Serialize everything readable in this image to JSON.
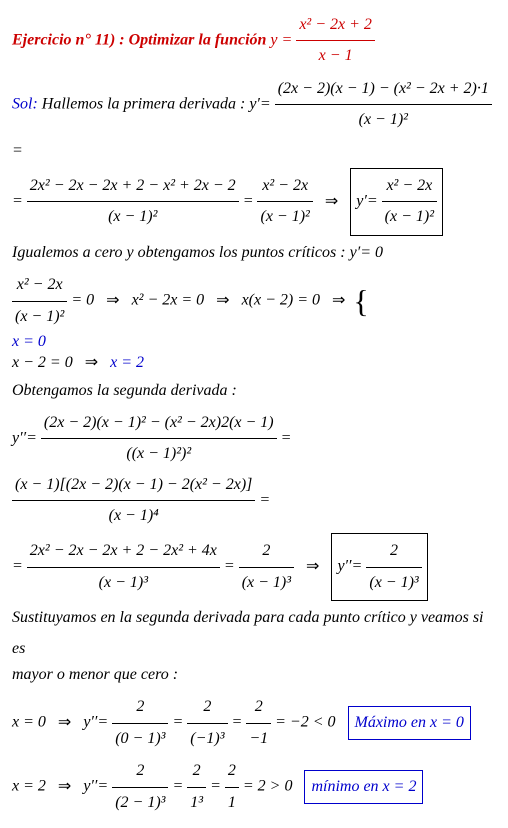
{
  "title_label": "Ejercicio n° 11)",
  "title_text": ":  Optimizar la función",
  "eq_lhs": "y =",
  "eq_num": "x² − 2x + 2",
  "eq_den": "x − 1",
  "sol_label": "Sol:",
  "line1_text": "Hallemos la primera derivada :",
  "line1_yp": "y′=",
  "line1_num": "(2x − 2)(x − 1) − (x² − 2x + 2)·1",
  "line1_den": "(x − 1)²",
  "eq_sign": "=",
  "line2_num1": "2x² − 2x − 2x + 2 − x² + 2x − 2",
  "line2_den1": "(x − 1)²",
  "line2_num2": "x² − 2x",
  "line2_den2": "(x − 1)²",
  "arrow": "⇒",
  "box1_lhs": "y′=",
  "box1_num": "x² − 2x",
  "box1_den": "(x − 1)²",
  "line3": "Igualemos a cero y obtengamos los puntos críticos :",
  "line3_eq": "y′= 0",
  "line4_num": "x² − 2x",
  "line4_den": "(x − 1)²",
  "line4_a": "= 0",
  "line4_b": "x² − 2x = 0",
  "line4_c": "x(x − 2) = 0",
  "case1": "x = 0",
  "case2": "x − 2 = 0",
  "case2_res": "x = 2",
  "line5": "Obtengamos la segunda derivada :",
  "line6_ypp": "y′′=",
  "line6_num1": "(2x − 2)(x − 1)² − (x² − 2x)2(x − 1)",
  "line6_den1": "((x − 1)²)²",
  "line6_num2": "(x − 1)[(2x − 2)(x − 1) − 2(x² − 2x)]",
  "line6_den2": "(x − 1)⁴",
  "line7_num1": "2x² − 2x − 2x + 2 − 2x² + 4x",
  "line7_den1": "(x − 1)³",
  "line7_num2": "2",
  "line7_den2": "(x − 1)³",
  "box2_lhs": "y′′=",
  "box2_num": "2",
  "box2_den": "(x − 1)³",
  "line8a": "Sustituyamos en la segunda derivada para cada punto crítico y veamos si es",
  "line8b": "mayor o menor que cero :",
  "line9_x": "x = 0",
  "line9_ypp": "y′′=",
  "line9_f1n": "2",
  "line9_f1d": "(0 − 1)³",
  "line9_f2n": "2",
  "line9_f2d": "(−1)³",
  "line9_f3n": "2",
  "line9_f3d": "−1",
  "line9_res": "= −2 < 0",
  "line9_box": "Máximo en x = 0",
  "line10_x": "x = 2",
  "line10_ypp": "y′′=",
  "line10_f1n": "2",
  "line10_f1d": "(2 − 1)³",
  "line10_f2n": "2",
  "line10_f2d": "1³",
  "line10_f3n": "2",
  "line10_f3d": "1",
  "line10_res": "= 2 > 0",
  "line10_box": "mínimo en x = 2"
}
